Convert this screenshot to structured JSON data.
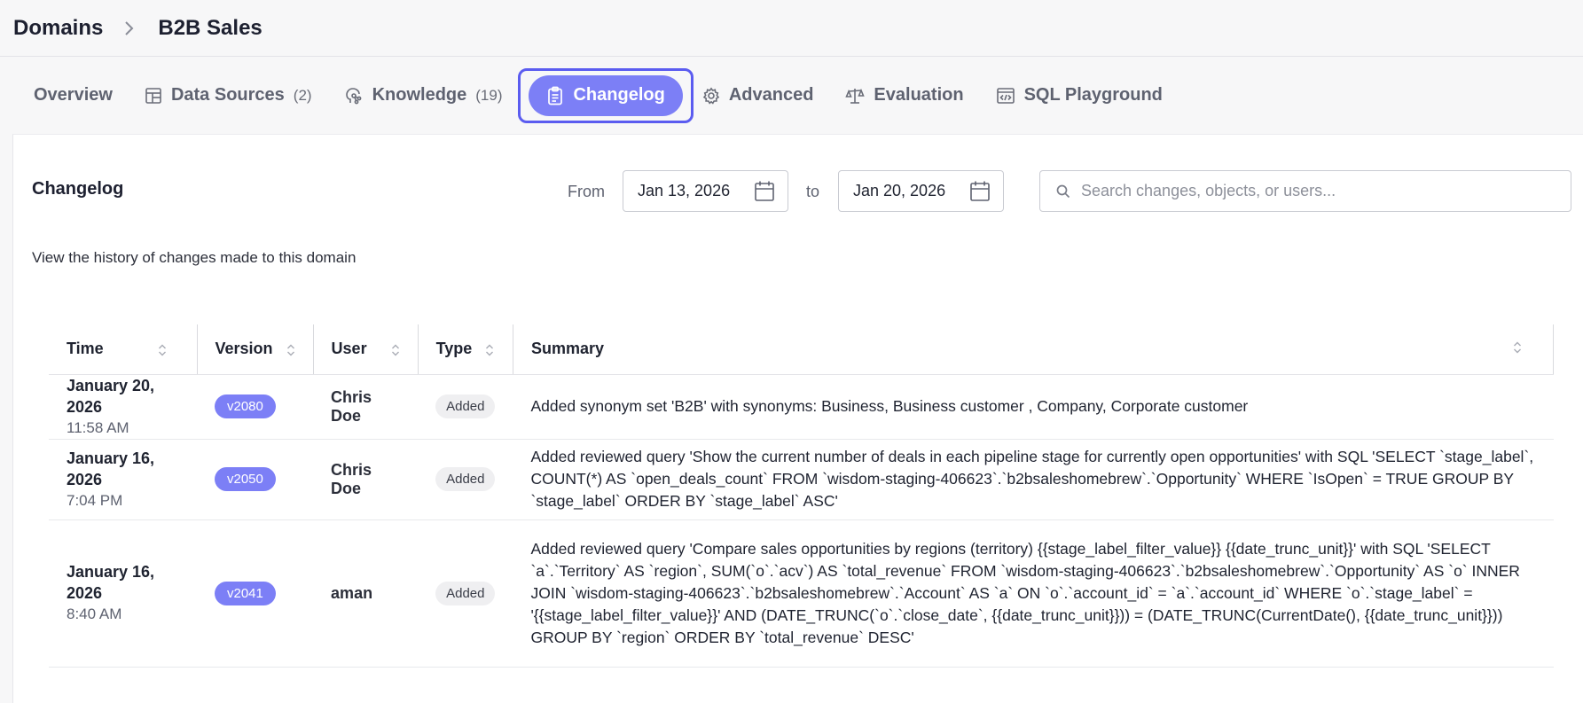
{
  "breadcrumb": {
    "root": "Domains",
    "current": "B2B Sales"
  },
  "tabs": [
    {
      "label": "Overview",
      "count": "",
      "icon": "none"
    },
    {
      "label": "Data Sources",
      "count": "(2)",
      "icon": "data-sources-icon"
    },
    {
      "label": "Knowledge",
      "count": "(19)",
      "icon": "knowledge-icon"
    },
    {
      "label": "Changelog",
      "count": "",
      "icon": "clipboard-icon",
      "active": true
    },
    {
      "label": "Advanced",
      "count": "",
      "icon": "gear-icon"
    },
    {
      "label": "Evaluation",
      "count": "",
      "icon": "scale-icon"
    },
    {
      "label": "SQL Playground",
      "count": "",
      "icon": "code-window-icon"
    }
  ],
  "changelog": {
    "title": "Changelog",
    "from_label": "From",
    "from_date": "Jan 13, 2026",
    "to_label": "to",
    "to_date": "Jan 20, 2026",
    "search_placeholder": "Search changes, objects, or users...",
    "subtitle": "View the history of changes made to this domain"
  },
  "table": {
    "headers": {
      "time": "Time",
      "version": "Version",
      "user": "User",
      "type": "Type",
      "summary": "Summary"
    },
    "rows": [
      {
        "date": "January 20, 2026",
        "time": "11:58 AM",
        "version": "v2080",
        "user": "Chris Doe",
        "type": "Added",
        "summary": "Added synonym set 'B2B' with synonyms: Business, Business customer , Company, Corporate customer"
      },
      {
        "date": "January 16, 2026",
        "time": "7:04 PM",
        "version": "v2050",
        "user": "Chris Doe",
        "type": "Added",
        "summary": "Added reviewed query 'Show the current number of deals in each pipeline stage for currently open opportunities' with SQL 'SELECT `stage_label`, COUNT(*) AS `open_deals_count` FROM `wisdom-staging-406623`.`b2bsaleshomebrew`.`Opportunity` WHERE `IsOpen` = TRUE GROUP BY `stage_label` ORDER BY `stage_label` ASC'"
      },
      {
        "date": "January 16, 2026",
        "time": "8:40 AM",
        "version": "v2041",
        "user": "aman",
        "type": "Added",
        "summary": "Added reviewed query 'Compare sales opportunities by regions (territory) {{stage_label_filter_value}} {{date_trunc_unit}}' with SQL 'SELECT `a`.`Territory` AS `region`, SUM(`o`.`acv`) AS `total_revenue` FROM `wisdom-staging-406623`.`b2bsaleshomebrew`.`Opportunity` AS `o` INNER JOIN `wisdom-staging-406623`.`b2bsaleshomebrew`.`Account` AS `a` ON `o`.`account_id` = `a`.`account_id` WHERE `o`.`stage_label` = '{{stage_label_filter_value}}' AND (DATE_TRUNC(`o`.`close_date`, {{date_trunc_unit}})) = (DATE_TRUNC(CurrentDate(), {{date_trunc_unit}})) GROUP BY `region` ORDER BY `total_revenue` DESC'"
      }
    ]
  },
  "colors": {
    "accent": "#7c7ff6",
    "accent_border": "#5b5cf0"
  }
}
